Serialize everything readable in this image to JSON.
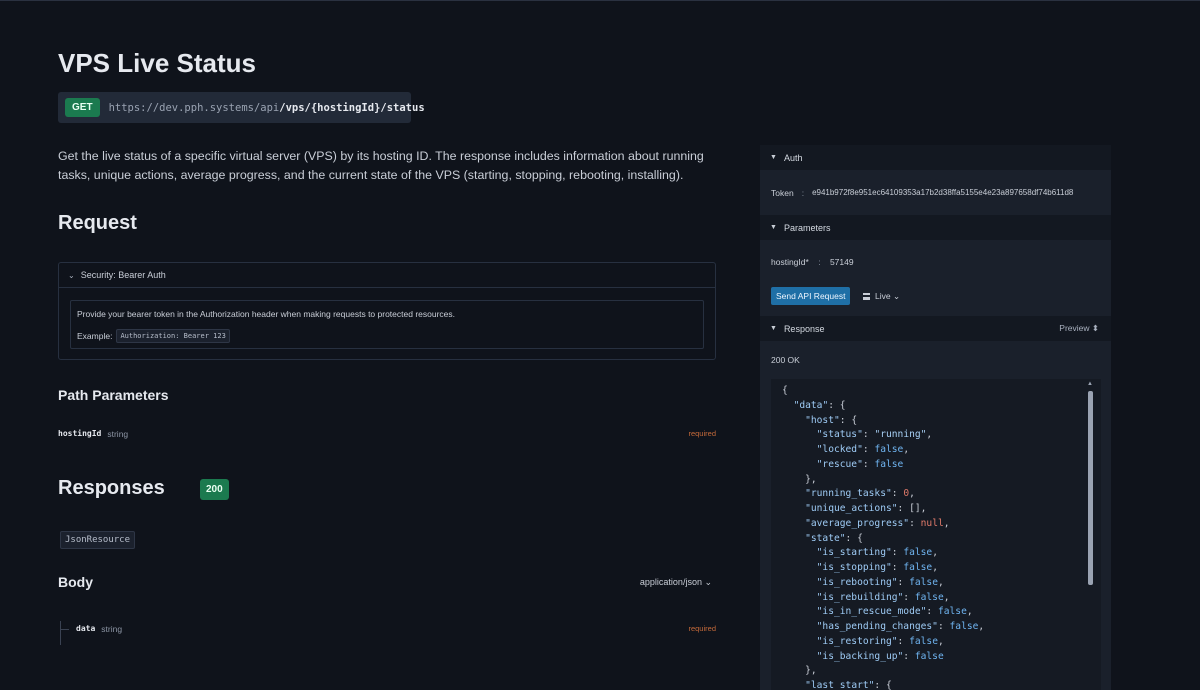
{
  "page": {
    "title": "VPS Live Status",
    "method": "GET",
    "url_base": "https://dev.pph.systems/api",
    "url_path": "/vps/{hostingId}/status",
    "description": "Get the live status of a specific virtual server (VPS) by its hosting ID. The response includes information about running tasks, unique actions, average progress, and the current state of the VPS (starting, stopping, rebooting, installing)."
  },
  "request": {
    "heading": "Request",
    "security_title": "Security: Bearer Auth",
    "security_text": "Provide your bearer token in the Authorization header when making requests to protected resources.",
    "example_label": "Example:",
    "example_code": "Authorization: Bearer 123"
  },
  "path_params": {
    "heading": "Path Parameters",
    "name": "hostingId",
    "type": "string",
    "required": "required"
  },
  "responses": {
    "heading": "Responses",
    "status_code": "200",
    "resource": "JsonResource",
    "body_heading": "Body",
    "content_type": "application/json ⌄",
    "body_field_name": "data",
    "body_field_type": "string",
    "body_field_required": "required"
  },
  "panel": {
    "auth_label": "Auth",
    "token_label": "Token",
    "token_sep": ":",
    "token_value": "e941b972f8e951ec64109353a17b2d38ffa5155e4e23a897658df74b611d8",
    "params_label": "Parameters",
    "hosting_label": "hostingId*",
    "hosting_value": "57149",
    "send_label": "Send API Request",
    "live_label": "Live ⌄",
    "response_label": "Response",
    "preview_label": "Preview ⬍",
    "status_text": "200 OK"
  },
  "response_json": [
    [
      [
        "p",
        "{"
      ]
    ],
    [
      [
        "p",
        "  "
      ],
      [
        "k",
        "\"data\""
      ],
      [
        "p",
        ": {"
      ]
    ],
    [
      [
        "p",
        "    "
      ],
      [
        "k",
        "\"host\""
      ],
      [
        "p",
        ": {"
      ]
    ],
    [
      [
        "p",
        "      "
      ],
      [
        "k",
        "\"status\""
      ],
      [
        "p",
        ": "
      ],
      [
        "s",
        "\"running\""
      ],
      [
        "p",
        ","
      ]
    ],
    [
      [
        "p",
        "      "
      ],
      [
        "k",
        "\"locked\""
      ],
      [
        "p",
        ": "
      ],
      [
        "b",
        "false"
      ],
      [
        "p",
        ","
      ]
    ],
    [
      [
        "p",
        "      "
      ],
      [
        "k",
        "\"rescue\""
      ],
      [
        "p",
        ": "
      ],
      [
        "b",
        "false"
      ]
    ],
    [
      [
        "p",
        "    },"
      ]
    ],
    [
      [
        "p",
        "    "
      ],
      [
        "k",
        "\"running_tasks\""
      ],
      [
        "p",
        ": "
      ],
      [
        "n",
        "0"
      ],
      [
        "p",
        ","
      ]
    ],
    [
      [
        "p",
        "    "
      ],
      [
        "k",
        "\"unique_actions\""
      ],
      [
        "p",
        ": [],"
      ]
    ],
    [
      [
        "p",
        "    "
      ],
      [
        "k",
        "\"average_progress\""
      ],
      [
        "p",
        ": "
      ],
      [
        "n",
        "null"
      ],
      [
        "p",
        ","
      ]
    ],
    [
      [
        "p",
        "    "
      ],
      [
        "k",
        "\"state\""
      ],
      [
        "p",
        ": {"
      ]
    ],
    [
      [
        "p",
        "      "
      ],
      [
        "k",
        "\"is_starting\""
      ],
      [
        "p",
        ": "
      ],
      [
        "b",
        "false"
      ],
      [
        "p",
        ","
      ]
    ],
    [
      [
        "p",
        "      "
      ],
      [
        "k",
        "\"is_stopping\""
      ],
      [
        "p",
        ": "
      ],
      [
        "b",
        "false"
      ],
      [
        "p",
        ","
      ]
    ],
    [
      [
        "p",
        "      "
      ],
      [
        "k",
        "\"is_rebooting\""
      ],
      [
        "p",
        ": "
      ],
      [
        "b",
        "false"
      ],
      [
        "p",
        ","
      ]
    ],
    [
      [
        "p",
        "      "
      ],
      [
        "k",
        "\"is_rebuilding\""
      ],
      [
        "p",
        ": "
      ],
      [
        "b",
        "false"
      ],
      [
        "p",
        ","
      ]
    ],
    [
      [
        "p",
        "      "
      ],
      [
        "k",
        "\"is_in_rescue_mode\""
      ],
      [
        "p",
        ": "
      ],
      [
        "b",
        "false"
      ],
      [
        "p",
        ","
      ]
    ],
    [
      [
        "p",
        "      "
      ],
      [
        "k",
        "\"has_pending_changes\""
      ],
      [
        "p",
        ": "
      ],
      [
        "b",
        "false"
      ],
      [
        "p",
        ","
      ]
    ],
    [
      [
        "p",
        "      "
      ],
      [
        "k",
        "\"is_restoring\""
      ],
      [
        "p",
        ": "
      ],
      [
        "b",
        "false"
      ],
      [
        "p",
        ","
      ]
    ],
    [
      [
        "p",
        "      "
      ],
      [
        "k",
        "\"is_backing_up\""
      ],
      [
        "p",
        ": "
      ],
      [
        "b",
        "false"
      ]
    ],
    [
      [
        "p",
        "    },"
      ]
    ],
    [
      [
        "p",
        "    "
      ],
      [
        "k",
        "\"last_start\""
      ],
      [
        "p",
        ": {"
      ]
    ]
  ]
}
